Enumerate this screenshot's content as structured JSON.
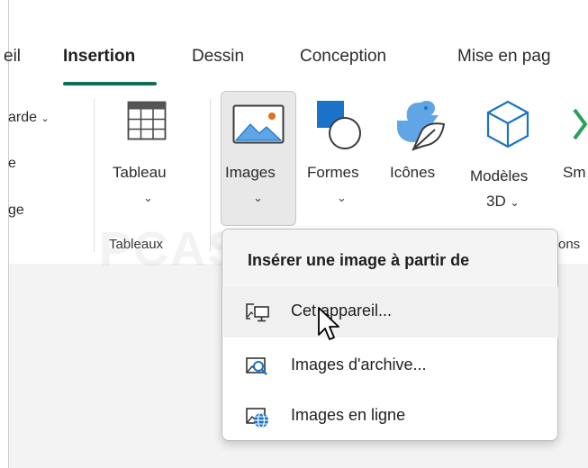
{
  "tabs": {
    "items": [
      {
        "label": "eil",
        "active": false
      },
      {
        "label": "Insertion",
        "active": true
      },
      {
        "label": "Dessin",
        "active": false
      },
      {
        "label": "Conception",
        "active": false
      },
      {
        "label": "Mise en pag",
        "active": false
      }
    ]
  },
  "ribbon": {
    "left_cutoff": {
      "line1": "arde",
      "line2": "e",
      "line3": "ge"
    },
    "tableau": {
      "label": "Tableau",
      "group_label": "Tableaux"
    },
    "images": {
      "label": "Images"
    },
    "formes": {
      "label": "Formes"
    },
    "icones": {
      "label": "Icônes"
    },
    "modeles3d": {
      "line1": "Modèles",
      "line2": "3D"
    },
    "smartart": {
      "label": "Sm"
    },
    "right_group_label": "ons"
  },
  "menu": {
    "title": "Insérer une image à partir de",
    "items": [
      {
        "label": "Cet appareil...",
        "icon": "device-image-icon",
        "hover": true
      },
      {
        "label": "Images d'archive...",
        "icon": "stock-images-icon",
        "hover": false
      },
      {
        "label": "Images en ligne",
        "icon": "online-images-icon",
        "hover": false
      }
    ]
  },
  "watermark": "PCASTUCES",
  "colors": {
    "accent": "#116c5c",
    "icon_blue": "#1a73c8",
    "icon_light": "#60a5e6",
    "smartart_green": "#2e9e5b"
  }
}
